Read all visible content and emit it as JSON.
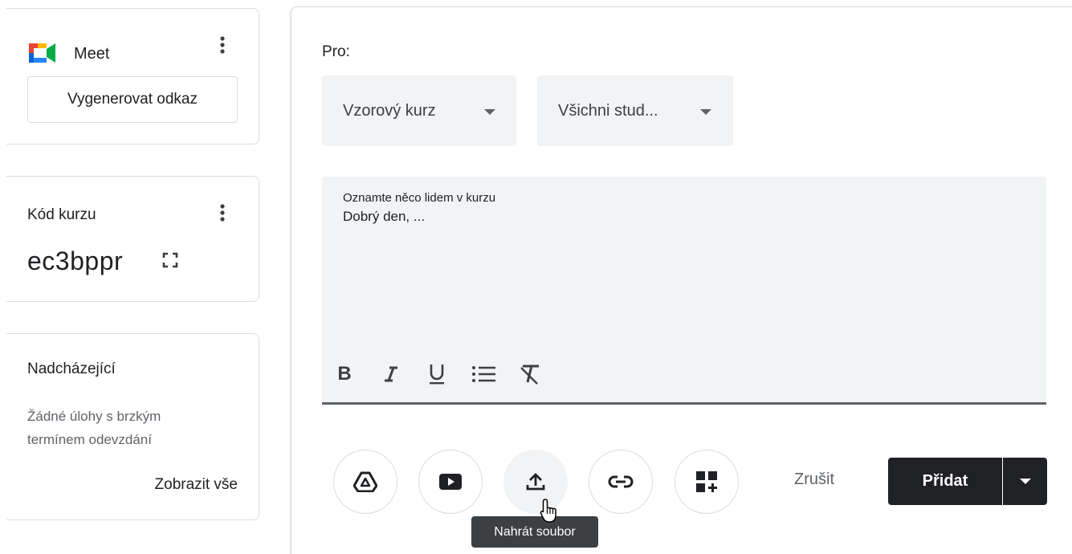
{
  "meet": {
    "title": "Meet",
    "generate_link": "Vygenerovat odkaz"
  },
  "course_code": {
    "label": "Kód kurzu",
    "value": "ec3bppr"
  },
  "upcoming": {
    "title": "Nadcházející",
    "empty_text": "Žádné úlohy s brzkým termínem odevzdání",
    "view_all": "Zobrazit vše"
  },
  "composer": {
    "for_label": "Pro:",
    "course_select": "Vzorový kurz",
    "students_select": "Všichni stud...",
    "editor_label": "Oznamte něco lidem v kurzu",
    "editor_text": "Dobrý den, ...",
    "format": {
      "bold": "B"
    },
    "cancel": "Zrušit",
    "post": "Přidat",
    "tooltip": "Nahrát soubor"
  },
  "icons": [
    "meet-logo-icon",
    "more-vert-icon",
    "fullscreen-icon",
    "bold-icon",
    "italic-icon",
    "underline-icon",
    "bulleted-list-icon",
    "clear-format-icon",
    "google-drive-icon",
    "youtube-icon",
    "upload-icon",
    "link-icon",
    "add-material-icon",
    "dropdown-arrow-icon",
    "hand-cursor-icon"
  ],
  "colors": {
    "dark_button": "#202124",
    "input_bg": "#f1f3f4",
    "border": "#dadce0",
    "secondary_text": "#5f6368"
  }
}
